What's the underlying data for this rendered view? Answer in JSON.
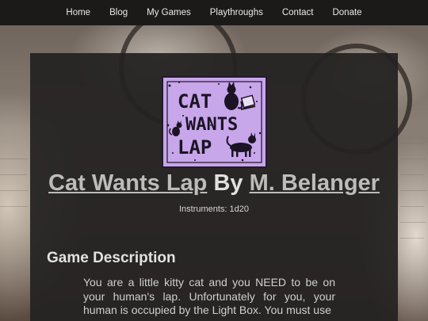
{
  "nav": {
    "items": [
      "Home",
      "Blog",
      "My Games",
      "Playthroughs",
      "Contact",
      "Donate"
    ]
  },
  "logo": {
    "lines": [
      "CAT",
      "WANTS",
      "LAP"
    ],
    "background": "#c8a6ea"
  },
  "game": {
    "title": "Cat Wants Lap",
    "by": "By",
    "author": "M. Belanger",
    "instruments": "Instruments: 1d20"
  },
  "description": {
    "heading": "Game Description",
    "text": "You are a little kitty cat and you NEED to be on your human's lap. Unfortunately for you, your human is occupied by the Light Box. You must use"
  },
  "colors": {
    "navbar": "#1c1a19",
    "panel": "#242222",
    "link": "#bcbcbc"
  }
}
